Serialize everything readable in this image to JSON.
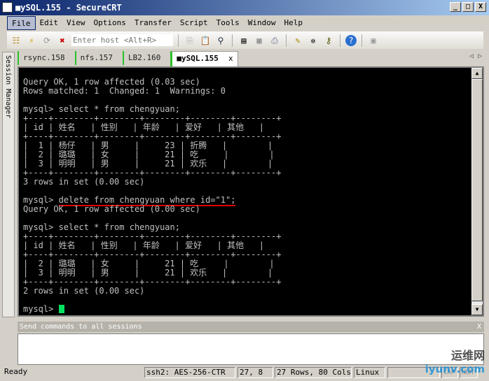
{
  "window": {
    "title": "■ySQL.155 - SecureCRT",
    "min": "_",
    "max": "□",
    "close": "X"
  },
  "menu": [
    "File",
    "Edit",
    "View",
    "Options",
    "Transfer",
    "Script",
    "Tools",
    "Window",
    "Help"
  ],
  "toolbar": {
    "host_placeholder": "Enter host <Alt+R>"
  },
  "sidebar": {
    "label": "Session Manager"
  },
  "tabs": [
    {
      "label": "rsync.158"
    },
    {
      "label": "nfs.157"
    },
    {
      "label": "LB2.160"
    },
    {
      "label": "■ySQL.155",
      "close": "x"
    }
  ],
  "tab_nav": "◁ ▷",
  "terminal": {
    "lines_a": "Query OK, 1 row affected (0.03 sec)\nRows matched: 1  Changed: 1  Warnings: 0\n\nmysql> select * from chengyuan;\n+----+--------+--------+--------+--------+--------+\n| id | 姓名   | 性别   | 年龄   | 爱好   | 其他   |\n+----+--------+--------+--------+--------+--------+\n|  1 | 杨仔   | 男     |     23 | 折腾   |        |\n|  2 | 璐璐   | 女     |     21 | 吃     |        |\n|  3 | 明明   | 男     |     21 | 欢乐   |        |\n+----+--------+--------+--------+--------+--------+\n3 rows in set (0.00 sec)\n\n",
    "prompt": "mysql> ",
    "delete_cmd": "delete from chengyuan where id=\"1\";",
    "lines_b": "\nQuery OK, 1 row affected (0.00 sec)\n\nmysql> select * from chengyuan;\n+----+--------+--------+--------+--------+--------+\n| id | 姓名   | 性别   | 年龄   | 爱好   | 其他   |\n+----+--------+--------+--------+--------+--------+\n|  2 | 璐璐   | 女     |     21 | 吃     |        |\n|  3 | 明明   | 男     |     21 | 欢乐   |        |\n+----+--------+--------+--------+--------+--------+\n2 rows in set (0.00 sec)\n\n",
    "final_prompt": "mysql> "
  },
  "send_bar": {
    "label": "Send commands to all sessions",
    "close": "X"
  },
  "status": {
    "ready": "Ready",
    "cipher": "ssh2: AES-256-CTR",
    "pos": "27,   8",
    "size": "27 Rows, 80 Cols",
    "os": "Linux",
    "cap": "CAP",
    "num": "NUM"
  },
  "watermark": {
    "cn": "运维网",
    "en": "iyunv.com"
  }
}
